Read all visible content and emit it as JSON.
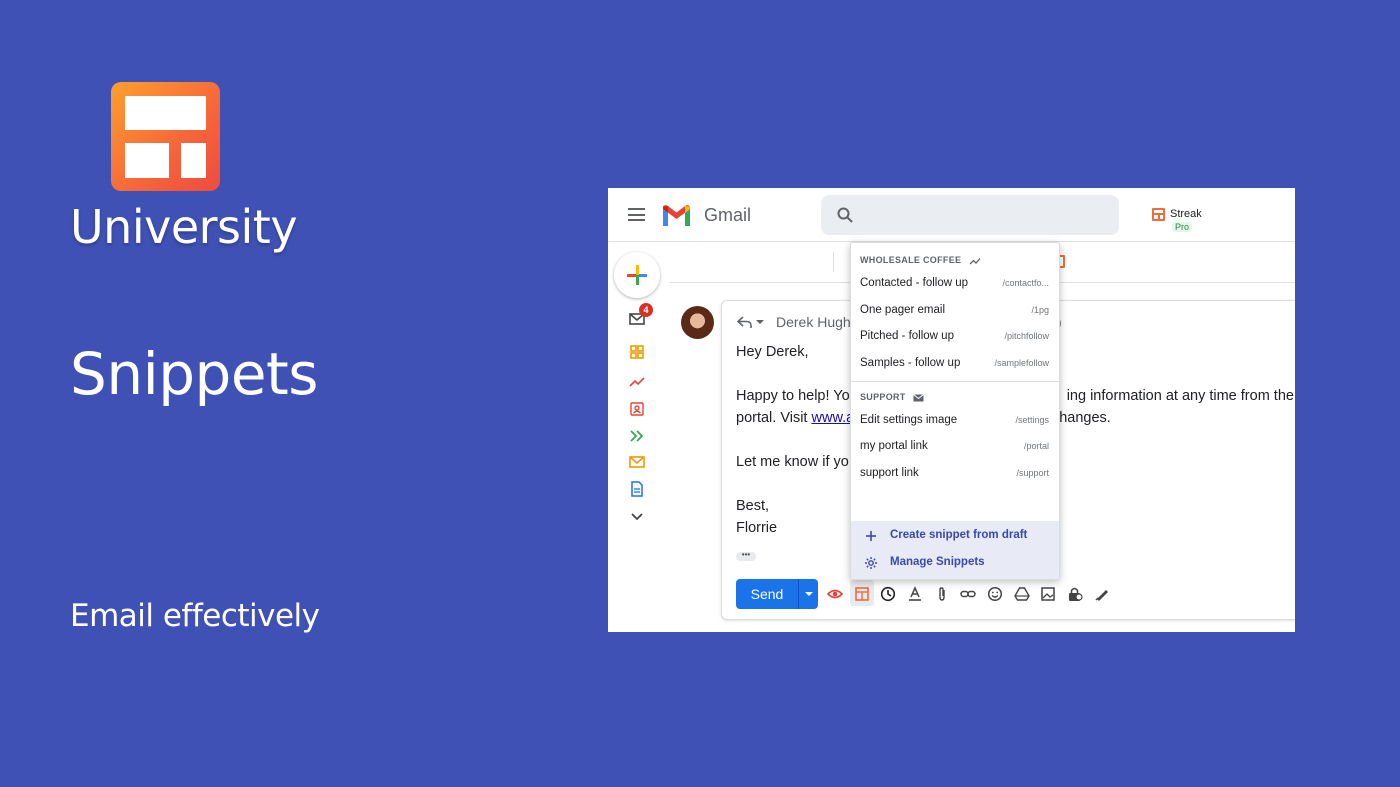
{
  "promo": {
    "brand": "University",
    "headline": "Snippets",
    "tagline": "Email effectively"
  },
  "gmail": {
    "app_name": "Gmail",
    "streak": {
      "name": "Streak",
      "plan": "Pro"
    },
    "unread_count": "4",
    "email": {
      "recipient": "Derek Hugh",
      "recipient_suffix": ")",
      "greeting": "Hey Derek,",
      "line1_start": "Happy to help! Yo",
      "line1_end": "ing information at any time from the",
      "line2_start": "portal. Visit ",
      "line2_link": "www.a",
      "line2_end": "hanges.",
      "line3": "Let me know if yo",
      "signoff": "Best,",
      "signature": "Florrie",
      "more": "•••"
    },
    "send_label": "Send"
  },
  "snippets": {
    "groups": [
      {
        "title": "WHOLESALE COFFEE",
        "icon": "trending-icon",
        "items": [
          {
            "name": "Contacted - follow up",
            "shortcut": "/contactfo..."
          },
          {
            "name": "One pager email",
            "shortcut": "/1pg"
          },
          {
            "name": "Pitched - follow up",
            "shortcut": "/pitchfollow"
          },
          {
            "name": "Samples - follow up",
            "shortcut": "/samplefollow"
          }
        ]
      },
      {
        "title": "SUPPORT",
        "icon": "mail-icon",
        "items": [
          {
            "name": "Edit settings image",
            "shortcut": "/settings"
          },
          {
            "name": "my portal link",
            "shortcut": "/portal"
          },
          {
            "name": "support link",
            "shortcut": "/support"
          }
        ]
      }
    ],
    "create_label": "Create snippet from draft",
    "manage_label": "Manage Snippets"
  },
  "colors": {
    "background": "#3f51b5",
    "send_button": "#1a73e8",
    "menu_footer": "#e8eaf6",
    "streak_accent": "#f26b3a"
  }
}
